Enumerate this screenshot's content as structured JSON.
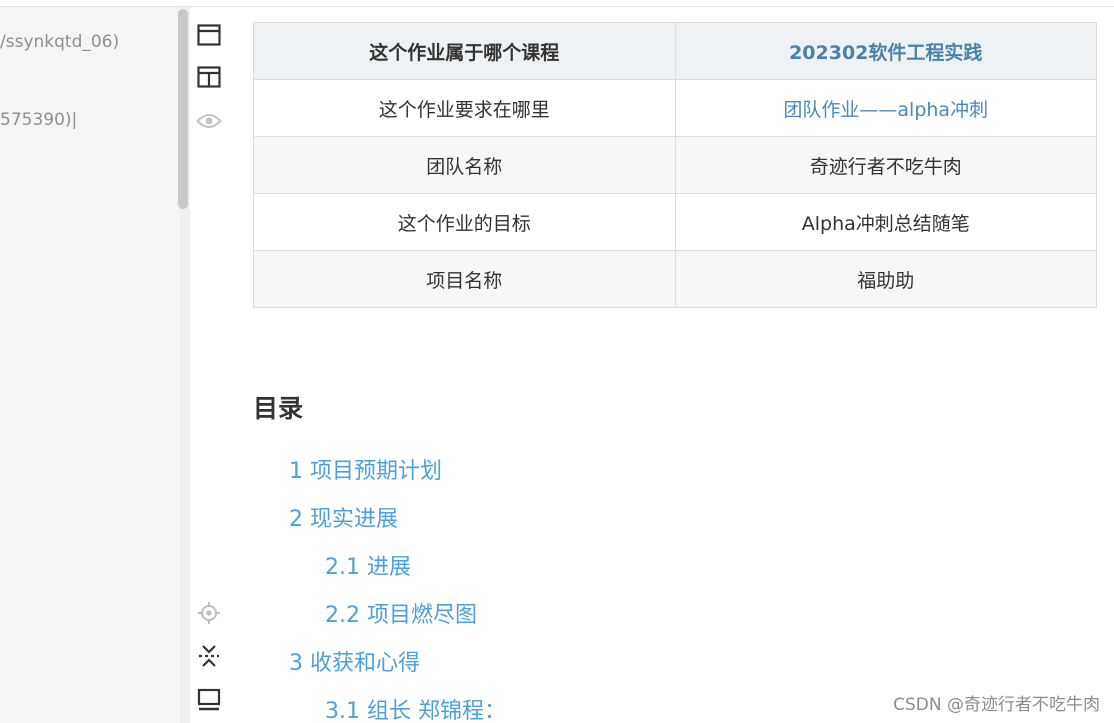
{
  "editor": {
    "line1": "/ssynkqtd_06)",
    "line2": "575390)|"
  },
  "toolbar": {
    "icons": [
      "single-column-icon",
      "split-view-icon",
      "eye-icon",
      "locate-icon",
      "collapse-icon",
      "monitor-icon"
    ]
  },
  "table": {
    "header": [
      "这个作业属于哪个课程",
      "202302软件工程实践"
    ],
    "rows": [
      [
        "这个作业要求在哪里",
        "团队作业——alpha冲刺"
      ],
      [
        "团队名称",
        "奇迹行者不吃牛肉"
      ],
      [
        "这个作业的目标",
        "Alpha冲刺总结随笔"
      ],
      [
        "项目名称",
        "福助助"
      ]
    ]
  },
  "toc": {
    "heading": "目录",
    "items": [
      {
        "label": "1 项目预期计划",
        "level": 1
      },
      {
        "label": "2 现实进展",
        "level": 1
      },
      {
        "label": "2.1 进展",
        "level": 2
      },
      {
        "label": "2.2 项目燃尽图",
        "level": 2
      },
      {
        "label": "3 收获和心得",
        "level": 1
      },
      {
        "label": "3.1 组长 郑锦程：",
        "level": 2
      }
    ]
  },
  "watermark": "CSDN @奇迹行者不吃牛肉",
  "colors": {
    "link": "#4f87b5",
    "toc": "#4da0d8",
    "header_bg": "#eef2f5"
  }
}
